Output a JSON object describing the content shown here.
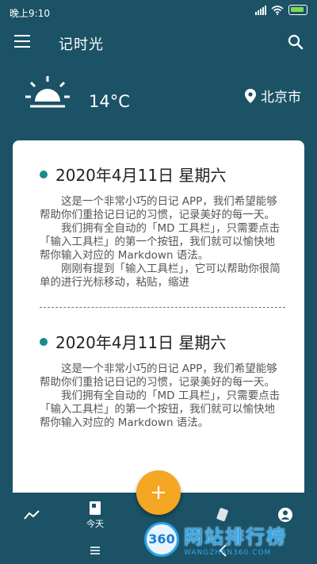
{
  "statusbar": {
    "time": "晚上9:10"
  },
  "appbar": {
    "title": "记时光"
  },
  "weather": {
    "temperature": "14°C",
    "location": "北京市"
  },
  "entries": [
    {
      "date": "2020年4月11日  星期六",
      "paragraphs": [
        "这是一个非常小巧的日记 APP，我们希望能够帮助你们重拾记日记的习惯，记录美好的每一天。",
        "我们拥有全自动的「MD 工具栏」，只需要点击「输入工具栏」的第一个按钮，我们就可以愉快地帮你输入对应的 Markdown 语法。",
        "刚刚有提到「输入工具栏」，它可以帮助你很简单的进行光标移动，粘贴，缩进"
      ]
    },
    {
      "date": "2020年4月11日  星期六",
      "paragraphs": [
        "这是一个非常小巧的日记 APP，我们希望能够帮助你们重拾记日记的习惯，记录美好的每一天。",
        "我们拥有全自动的「MD 工具栏」，只需要点击「输入工具栏」的第一个按钮，我们就可以愉快地帮你输入对应的 Markdown 语法。"
      ]
    }
  ],
  "bottomnav": {
    "items": [
      {
        "label": "",
        "icon": "trend-icon"
      },
      {
        "label": "今天",
        "icon": "book-icon"
      },
      {
        "label": "",
        "icon": "cards-icon"
      },
      {
        "label": "",
        "icon": "profile-icon"
      }
    ],
    "fab_label": "+"
  },
  "watermark": {
    "cn": "网站排行榜",
    "en": "WANGZHAN360.COM",
    "logo": "360"
  },
  "colors": {
    "primary": "#1b5266",
    "accent": "#f5a623",
    "dot": "#1b8a8a"
  }
}
